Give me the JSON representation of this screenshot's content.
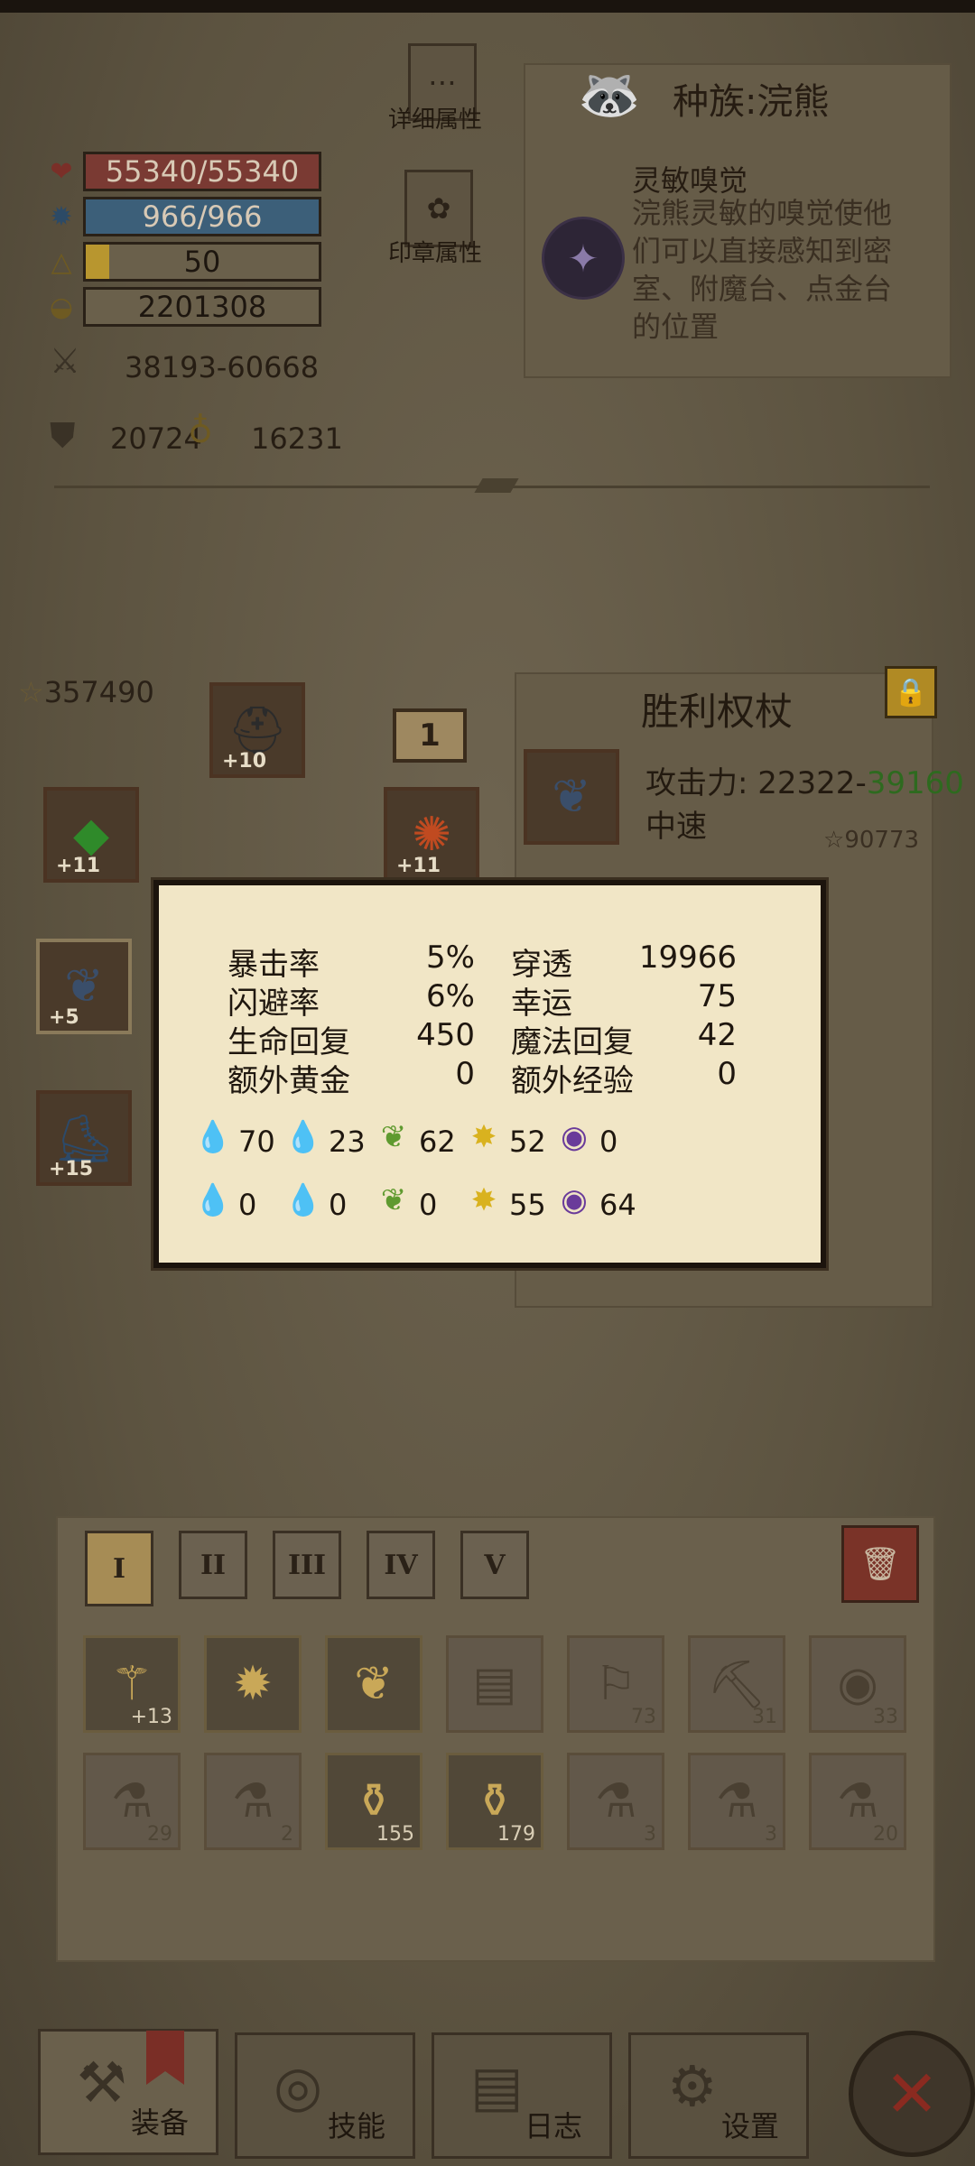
{
  "stats": {
    "hp": "55340/55340",
    "mp": "966/966",
    "level": "50",
    "gold": "2201308",
    "attack": "38193-60668",
    "defense": "20724",
    "magic_def": "16231"
  },
  "buttons": {
    "detail_attr": "详细属性",
    "seal_attr": "印章属性"
  },
  "race": {
    "title": "种族:浣熊",
    "trait_name": "灵敏嗅觉",
    "trait_desc": "浣熊灵敏的嗅觉使他们可以直接感知到密室、附魔台、点金台的位置"
  },
  "equipment": {
    "score": "357490",
    "slots": [
      {
        "plus": "+10"
      },
      {
        "plus": "1"
      },
      {
        "plus": "+11"
      },
      {
        "plus": "+11"
      },
      {
        "plus": "+5"
      },
      {
        "plus": "+15"
      }
    ]
  },
  "item": {
    "name": "胜利权杖",
    "attack_label": "攻击力:",
    "attack_min": "22322",
    "attack_sep": "-",
    "attack_max": "39160",
    "speed": "中速",
    "score": "90773"
  },
  "popup": {
    "rows": [
      {
        "l1": "暴击率",
        "v1": "5%",
        "l2": "穿透",
        "v2": "19966"
      },
      {
        "l1": "闪避率",
        "v1": "6%",
        "l2": "幸运",
        "v2": "75"
      },
      {
        "l1": "生命回复",
        "v1": "450",
        "l2": "魔法回复",
        "v2": "42"
      },
      {
        "l1": "额外黄金",
        "v1": "0",
        "l2": "额外经验",
        "v2": "0"
      }
    ],
    "elements_attack": [
      "70",
      "23",
      "62",
      "52",
      "0"
    ],
    "elements_resist": [
      "0",
      "0",
      "0",
      "55",
      "64"
    ],
    "element_icons": [
      "fire-icon",
      "water-icon",
      "leaf-icon",
      "lightning-icon",
      "arcane-icon"
    ],
    "element_colors": [
      "#c5321e",
      "#2d7fb8",
      "#5f9a2f",
      "#d9b21f",
      "#6a3b9a"
    ]
  },
  "inventory": {
    "tabs": [
      "I",
      "II",
      "III",
      "IV",
      "V"
    ],
    "row1": [
      {
        "name": "scepter-icon",
        "n": "+13"
      },
      {
        "name": "spiked-armor-icon",
        "n": ""
      },
      {
        "name": "winged-armor-icon",
        "n": ""
      },
      {
        "name": "book-icon",
        "n": ""
      },
      {
        "name": "scroll-icon",
        "n": "73"
      },
      {
        "name": "pickaxe-icon",
        "n": "31"
      },
      {
        "name": "eye-scroll-icon",
        "n": "33"
      }
    ],
    "row2": [
      {
        "name": "green-potion-icon",
        "n": "29"
      },
      {
        "name": "red-potion-icon",
        "n": "2"
      },
      {
        "name": "yellow-potion-icon",
        "n": "155"
      },
      {
        "name": "armor-potion-icon",
        "n": "179"
      },
      {
        "name": "blue-flask-icon",
        "n": "3"
      },
      {
        "name": "red-flask-icon",
        "n": "3"
      },
      {
        "name": "orange-flask-icon",
        "n": "20"
      }
    ]
  },
  "nav": {
    "equip": "装备",
    "skill": "技能",
    "log": "日志",
    "settings": "设置"
  }
}
